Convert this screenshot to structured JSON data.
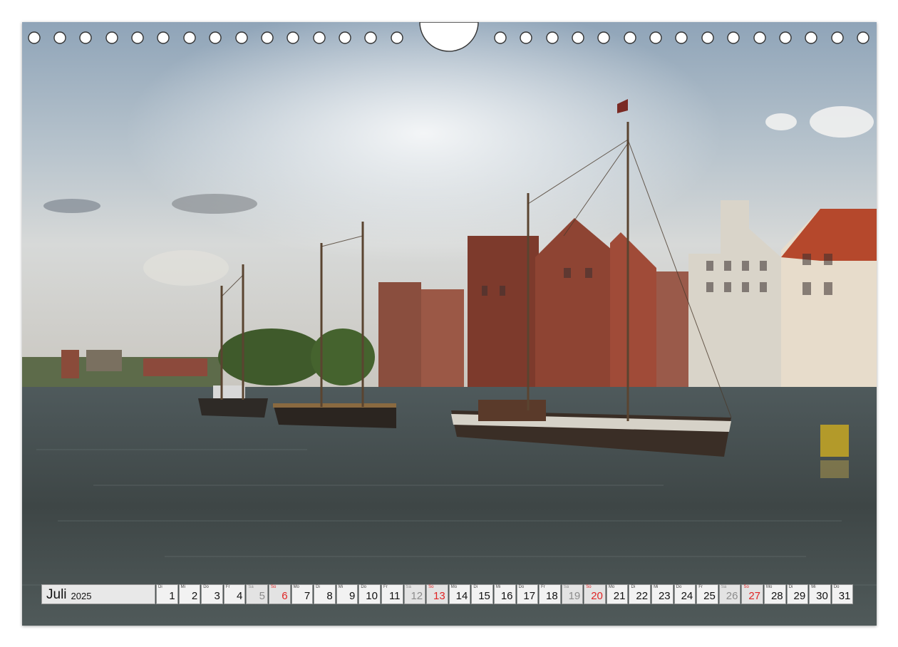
{
  "calendar": {
    "month": "Juli",
    "year": "2025",
    "days": [
      {
        "wd": "Di",
        "n": "1",
        "t": "w"
      },
      {
        "wd": "Mi",
        "n": "2",
        "t": "w"
      },
      {
        "wd": "Do",
        "n": "3",
        "t": "w"
      },
      {
        "wd": "Fr",
        "n": "4",
        "t": "w"
      },
      {
        "wd": "Sa",
        "n": "5",
        "t": "sat"
      },
      {
        "wd": "So",
        "n": "6",
        "t": "sun"
      },
      {
        "wd": "Mo",
        "n": "7",
        "t": "w"
      },
      {
        "wd": "Di",
        "n": "8",
        "t": "w"
      },
      {
        "wd": "Mi",
        "n": "9",
        "t": "w"
      },
      {
        "wd": "Do",
        "n": "10",
        "t": "w"
      },
      {
        "wd": "Fr",
        "n": "11",
        "t": "w"
      },
      {
        "wd": "Sa",
        "n": "12",
        "t": "sat"
      },
      {
        "wd": "So",
        "n": "13",
        "t": "sun"
      },
      {
        "wd": "Mo",
        "n": "14",
        "t": "w"
      },
      {
        "wd": "Di",
        "n": "15",
        "t": "w"
      },
      {
        "wd": "Mi",
        "n": "16",
        "t": "w"
      },
      {
        "wd": "Do",
        "n": "17",
        "t": "w"
      },
      {
        "wd": "Fr",
        "n": "18",
        "t": "w"
      },
      {
        "wd": "Sa",
        "n": "19",
        "t": "sat"
      },
      {
        "wd": "So",
        "n": "20",
        "t": "sun"
      },
      {
        "wd": "Mo",
        "n": "21",
        "t": "w"
      },
      {
        "wd": "Di",
        "n": "22",
        "t": "w"
      },
      {
        "wd": "Mi",
        "n": "23",
        "t": "w"
      },
      {
        "wd": "Do",
        "n": "24",
        "t": "w"
      },
      {
        "wd": "Fr",
        "n": "25",
        "t": "w"
      },
      {
        "wd": "Sa",
        "n": "26",
        "t": "sat"
      },
      {
        "wd": "So",
        "n": "27",
        "t": "sun"
      },
      {
        "wd": "Mo",
        "n": "28",
        "t": "w"
      },
      {
        "wd": "Di",
        "n": "29",
        "t": "w"
      },
      {
        "wd": "Mi",
        "n": "30",
        "t": "w"
      },
      {
        "wd": "Do",
        "n": "31",
        "t": "w"
      }
    ]
  },
  "colors": {
    "sunday": "#e02424",
    "saturday": "#8c8c8c",
    "cell": "#f2f2f2"
  }
}
